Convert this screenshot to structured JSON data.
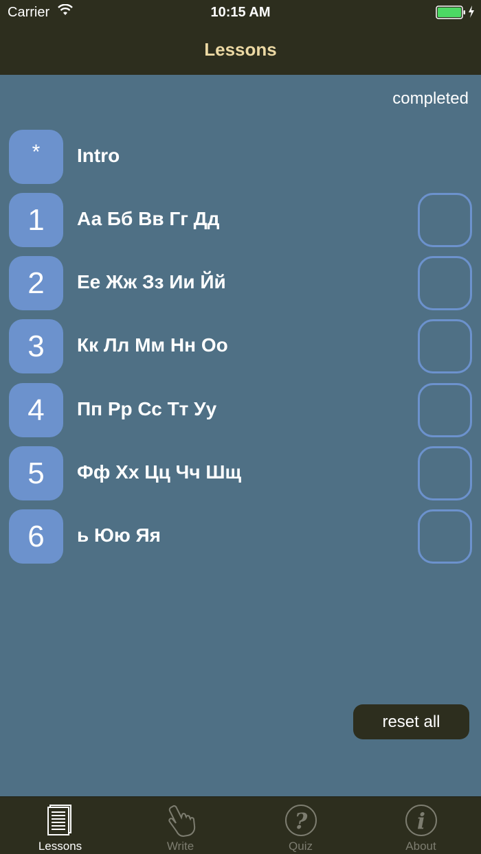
{
  "status_bar": {
    "carrier": "Carrier",
    "time": "10:15 AM",
    "battery_color": "#4cd964"
  },
  "nav": {
    "title": "Lessons"
  },
  "header": {
    "completed_label": "completed"
  },
  "lessons": [
    {
      "number": "*",
      "title": "Intro",
      "has_checkbox": false
    },
    {
      "number": "1",
      "title": "Аа Бб Вв Гг Дд",
      "has_checkbox": true,
      "completed": false
    },
    {
      "number": "2",
      "title": "Ее Жж Зз Ии Йй",
      "has_checkbox": true,
      "completed": false
    },
    {
      "number": "3",
      "title": "Кк Лл Мм Нн Оо",
      "has_checkbox": true,
      "completed": false
    },
    {
      "number": "4",
      "title": "Пп Рр Сс Тт Уу",
      "has_checkbox": true,
      "completed": false
    },
    {
      "number": "5",
      "title": "Фф Хх Цц Чч Шщ",
      "has_checkbox": true,
      "completed": false
    },
    {
      "number": "6",
      "title": "ь Юю Яя",
      "has_checkbox": true,
      "completed": false
    }
  ],
  "actions": {
    "reset_label": "reset all"
  },
  "tab_bar": {
    "tabs": [
      {
        "label": "Lessons",
        "icon": "document-icon",
        "active": true
      },
      {
        "label": "Write",
        "icon": "hand-pointer-icon",
        "active": false
      },
      {
        "label": "Quiz",
        "icon": "question-icon",
        "active": false
      },
      {
        "label": "About",
        "icon": "info-icon",
        "active": false
      }
    ]
  },
  "colors": {
    "background": "#4f7085",
    "bar": "#2d2e1e",
    "accent": "#6c92cd",
    "title": "#ecd9a4"
  }
}
